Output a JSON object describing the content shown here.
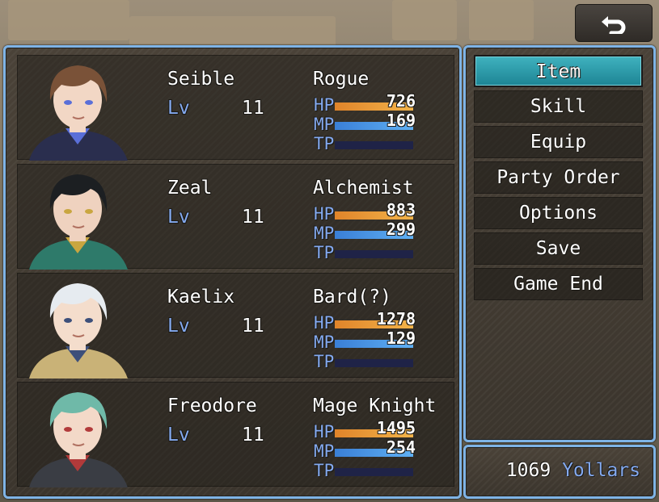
{
  "back_button": {
    "icon": "return-arrow-icon"
  },
  "actors": [
    {
      "name": "Seible",
      "class": "Rogue",
      "level_label": "Lv",
      "level": "11",
      "hp_label": "HP",
      "hp": "726",
      "hp_rate": 1.0,
      "mp_label": "MP",
      "mp": "169",
      "mp_rate": 1.0,
      "tp_label": "TP",
      "tp_rate": 0,
      "colors": {
        "hair": "#7a5238",
        "outfit": "#2a2e4e",
        "skin": "#f2d7c5",
        "accent": "#5a6fd8"
      }
    },
    {
      "name": "Zeal",
      "class": "Alchemist",
      "level_label": "Lv",
      "level": "11",
      "hp_label": "HP",
      "hp": "883",
      "hp_rate": 1.0,
      "mp_label": "MP",
      "mp": "299",
      "mp_rate": 1.0,
      "tp_label": "TP",
      "tp_rate": 0,
      "colors": {
        "hair": "#1c1f22",
        "outfit": "#2e7a6a",
        "skin": "#efd2bf",
        "accent": "#c9a640"
      }
    },
    {
      "name": "Kaelix",
      "class": "Bard(?)",
      "level_label": "Lv",
      "level": "11",
      "hp_label": "HP",
      "hp": "1278",
      "hp_rate": 1.0,
      "mp_label": "MP",
      "mp": "129",
      "mp_rate": 1.0,
      "tp_label": "TP",
      "tp_rate": 0,
      "colors": {
        "hair": "#e6ebf0",
        "outfit": "#c9b277",
        "skin": "#f4ddcc",
        "accent": "#3c4f7a"
      }
    },
    {
      "name": "Freodore",
      "class": "Mage Knight",
      "level_label": "Lv",
      "level": "11",
      "hp_label": "HP",
      "hp": "1495",
      "hp_rate": 1.0,
      "mp_label": "MP",
      "mp": "254",
      "mp_rate": 1.0,
      "tp_label": "TP",
      "tp_rate": 0,
      "colors": {
        "hair": "#6fb9a8",
        "outfit": "#3a3d44",
        "skin": "#f3d9c8",
        "accent": "#b23a3a"
      }
    }
  ],
  "commands": [
    {
      "label": "Item",
      "selected": true
    },
    {
      "label": "Skill",
      "selected": false
    },
    {
      "label": "Equip",
      "selected": false
    },
    {
      "label": "Party Order",
      "selected": false
    },
    {
      "label": "Options",
      "selected": false
    },
    {
      "label": "Save",
      "selected": false
    },
    {
      "label": "Game End",
      "selected": false
    }
  ],
  "gold": {
    "value": "1069",
    "unit": "Yollars"
  },
  "theme": {
    "window_border": "#7fb4e6",
    "system_text": "#84aaf0",
    "selected_command": "#2a9ba8",
    "hp_gauge": "#e8953a",
    "mp_gauge": "#4a98e6",
    "tp_gauge_bg": "#1f2347"
  }
}
